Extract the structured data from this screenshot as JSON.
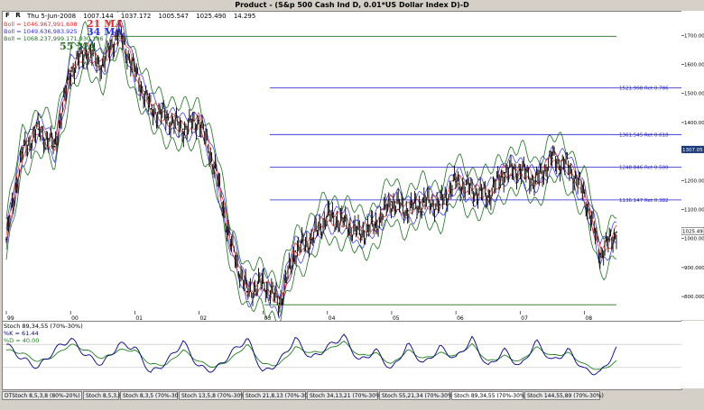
{
  "window": {
    "title": "Product - (S&p 500 Cash Ind D, 0.01*US Dollar Index  D)-D",
    "fr_label": "F R"
  },
  "header": {
    "date": "Thu 5-Jun-2008",
    "open": "1007.144",
    "high": "1037.172",
    "low": "1005.547",
    "close": "1025.490",
    "change": "14.295"
  },
  "boll": [
    {
      "label": "Boll = 1046.967,991.608",
      "ma_label": "21 MA",
      "color": "#e03030"
    },
    {
      "label": "Boll = 1049.636,983.925",
      "ma_label": "34 MA",
      "color": "#3030e0"
    },
    {
      "label": "Boll = 1068.237,999.171,930.106",
      "ma_label": "55 MA",
      "color": "#207020"
    }
  ],
  "price_axis": {
    "ticks": [
      "1700.000",
      "1600.000",
      "1500.000",
      "1400.000",
      "1300.000",
      "1200.000",
      "1100.000",
      "1000.000",
      "900.000",
      "800.000"
    ],
    "current_value": "1025.49",
    "marker_value": "1307.05"
  },
  "fib_levels": [
    {
      "label": "1521.998 Ret 0.786",
      "value": 1521.998
    },
    {
      "label": "1361.545 Ret 0.618",
      "value": 1361.545
    },
    {
      "label": "1248.846 Ret 0.500",
      "value": 1248.846
    },
    {
      "label": "1136.147 Ret 0.382",
      "value": 1136.147
    }
  ],
  "year_labels": [
    "99",
    "00",
    "01",
    "02",
    "03",
    "04",
    "05",
    "06",
    "07",
    "08"
  ],
  "stoch": {
    "title": "Stoch 89,34,55 (70%-30%)",
    "k_label": "%K = 61.44",
    "d_label": "%D = 40.00",
    "k_color": "#000080",
    "d_color": "#208020"
  },
  "tabs": [
    {
      "label": "DTStoch 8,5,3,8 (80%-20%)",
      "active": false
    },
    {
      "label": "Stoch 8,5,3,8",
      "active": false
    },
    {
      "label": "Stoch 8,3,5 (70%-30%)",
      "active": false
    },
    {
      "label": "Stoch 13,5,8 (70%-30%)",
      "active": false
    },
    {
      "label": "Stoch 21,8,13 (70%-30%)",
      "active": false
    },
    {
      "label": "Stoch 34,13,21 (70%-30%)",
      "active": false
    },
    {
      "label": "Stoch 55,21,34 (70%-30%)",
      "active": false
    },
    {
      "label": "Stoch 89,34,55 (70%-30%)",
      "active": true
    },
    {
      "label": "Stoch 144,55,89 (70%-30%)",
      "active": false
    }
  ],
  "chart_data": {
    "type": "line",
    "x": [
      "1999-01",
      "1999-04",
      "1999-07",
      "1999-10",
      "2000-01",
      "2000-04",
      "2000-07",
      "2000-10",
      "2001-01",
      "2001-04",
      "2001-07",
      "2001-10",
      "2002-01",
      "2002-04",
      "2002-07",
      "2002-10",
      "2003-01",
      "2003-04",
      "2003-07",
      "2003-10",
      "2004-01",
      "2004-04",
      "2004-07",
      "2004-10",
      "2005-01",
      "2005-04",
      "2005-07",
      "2005-10",
      "2006-01",
      "2006-04",
      "2006-07",
      "2006-10",
      "2007-01",
      "2007-04",
      "2007-07",
      "2007-10",
      "2008-01",
      "2008-04",
      "2008-06"
    ],
    "series": [
      {
        "name": "Product",
        "values": [
          1000,
          1300,
          1380,
          1320,
          1580,
          1650,
          1600,
          1720,
          1580,
          1450,
          1420,
          1380,
          1410,
          1250,
          980,
          820,
          850,
          780,
          960,
          1000,
          1080,
          1060,
          1020,
          1050,
          1130,
          1100,
          1130,
          1120,
          1200,
          1170,
          1150,
          1230,
          1240,
          1200,
          1280,
          1250,
          1160,
          950,
          1025
        ]
      }
    ],
    "ylim": [
      760,
      1760
    ],
    "stoch_k": [
      70,
      45,
      30,
      60,
      80,
      50,
      35,
      70,
      65,
      20,
      40,
      75,
      30,
      25,
      55,
      80,
      20,
      40,
      80,
      45,
      65,
      85,
      40,
      60,
      25,
      70,
      35,
      65,
      45,
      80,
      30,
      60,
      30,
      75,
      40,
      60,
      25,
      20,
      61.44
    ],
    "stoch_d": [
      60,
      55,
      40,
      50,
      70,
      60,
      45,
      60,
      60,
      35,
      35,
      60,
      40,
      30,
      45,
      70,
      35,
      35,
      65,
      55,
      60,
      75,
      50,
      55,
      35,
      60,
      45,
      55,
      50,
      70,
      40,
      50,
      40,
      65,
      50,
      55,
      35,
      25,
      40.0
    ],
    "stoch_ylim": [
      0,
      100
    ]
  }
}
